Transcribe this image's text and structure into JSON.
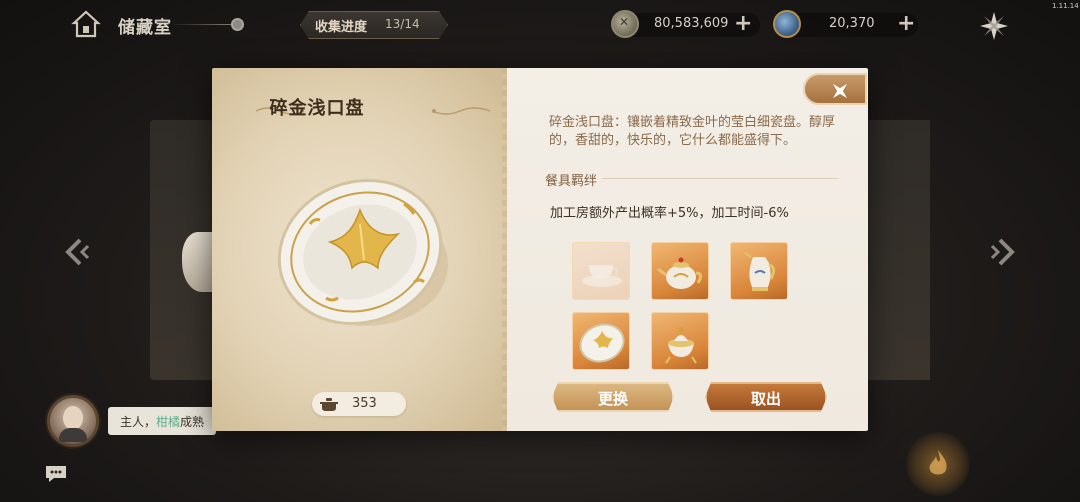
{
  "version": "1.11.14",
  "header": {
    "room_title": "储藏室",
    "progress_label": "收集进度",
    "progress_value": "13/14"
  },
  "currencies": [
    {
      "icon": "coin-icon",
      "value": "80,583,609",
      "add_label": "+"
    },
    {
      "icon": "gem-icon",
      "value": "20,370",
      "add_label": "+"
    }
  ],
  "item": {
    "name": "碎金浅口盘",
    "count": "353",
    "description": "碎金浅口盘：镶嵌着精致金叶的莹白细瓷盘。醇厚的，香甜的，快乐的，它什么都能盛得下。",
    "set_section_title": "餐具羁绊",
    "set_effect": "加工房额外产出概率+5%，加工时间-6%"
  },
  "set_items": [
    {
      "name": "teacup",
      "state": "dim"
    },
    {
      "name": "teapot",
      "state": "owned"
    },
    {
      "name": "pitcher",
      "state": "owned"
    },
    {
      "name": "plate",
      "state": "owned"
    },
    {
      "name": "sugar-bowl",
      "state": "owned"
    }
  ],
  "buttons": {
    "swap": "更换",
    "remove": "取出"
  },
  "chat": {
    "prefix": "主人，",
    "highlight": "柑橘",
    "suffix": "成熟"
  },
  "colors": {
    "accent_brown": "#a4713f",
    "gold": "#d4a23c",
    "chat_highlight": "#5fae8f"
  }
}
